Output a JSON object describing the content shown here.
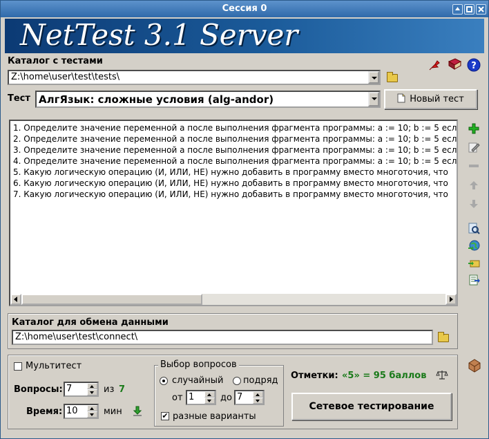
{
  "window": {
    "title": "Сессия 0"
  },
  "banner": {
    "text": "NetTest 3.1 Server"
  },
  "catalog": {
    "label": "Каталог с тестами",
    "path": "Z:\\home\\user\\test\\tests\\"
  },
  "test": {
    "label": "Тест",
    "selected": "АлгЯзык: сложные условия (alg-andor)",
    "new_button": "Новый тест"
  },
  "questions": [
    "1. Определите значение переменной а после выполнения фрагмента программы:  a := 10; b := 5 есл",
    "2. Определите значение переменной а после выполнения фрагмента программы:  a := 10; b := 5 есл",
    "3. Определите значение переменной а после выполнения фрагмента программы:  a := 10; b := 5 есл",
    "4. Определите значение переменной а после выполнения фрагмента программы:  a := 10; b := 5 есл",
    "5. Какую логическую операцию (И, ИЛИ, НЕ) нужно добавить в программу вместо многоточия, что",
    "6. Какую логическую операцию (И, ИЛИ, НЕ) нужно добавить в программу вместо многоточия, что",
    "7. Какую логическую операцию (И, ИЛИ, НЕ) нужно добавить в программу вместо многоточия, что"
  ],
  "exchange": {
    "label": "Каталог для обмена данными",
    "path": "Z:\\home\\user\\test\\connect\\"
  },
  "settings": {
    "multitest": "Мультитест",
    "questions_label": "Вопросы:",
    "questions_value": "7",
    "of_label": "из",
    "total": "7",
    "time_label": "Время:",
    "time_value": "10",
    "min_label": "мин"
  },
  "selection": {
    "legend": "Выбор вопросов",
    "random": "случайный",
    "sequential": "подряд",
    "from_label": "от",
    "from_value": "1",
    "to_label": "до",
    "to_value": "7",
    "variants": "разные варианты"
  },
  "marks": {
    "label": "Отметки:",
    "value": "«5» = 95 баллов"
  },
  "network_button": "Сетевое тестирование",
  "colors": {
    "green_text": "#1a7a1a",
    "banner": "#0c3a74"
  }
}
